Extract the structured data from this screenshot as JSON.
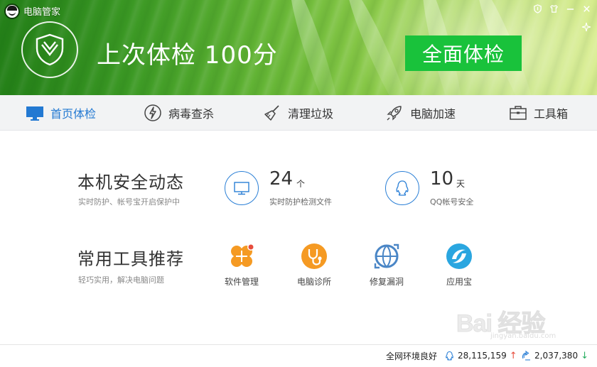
{
  "app": {
    "title": "电脑管家"
  },
  "window_controls": [
    "shield-icon",
    "shirt-icon",
    "minimize-icon",
    "close-icon"
  ],
  "header": {
    "last_check_text": "上次体检 100分",
    "full_check_button": "全面体检"
  },
  "nav": {
    "items": [
      {
        "label": "首页体检",
        "icon": "monitor-icon",
        "active": true
      },
      {
        "label": "病毒查杀",
        "icon": "lightning-icon",
        "active": false
      },
      {
        "label": "清理垃圾",
        "icon": "broom-icon",
        "active": false
      },
      {
        "label": "电脑加速",
        "icon": "rocket-icon",
        "active": false
      },
      {
        "label": "工具箱",
        "icon": "toolbox-icon",
        "active": false
      }
    ]
  },
  "security": {
    "title": "本机安全动态",
    "subtitle": "实时防护、帐号宝开启保护中",
    "stats": [
      {
        "value": "24",
        "unit": "个",
        "desc": "实时防护检测文件",
        "icon": "monitor-icon"
      },
      {
        "value": "10",
        "unit": "天",
        "desc": "QQ帐号安全",
        "icon": "qq-penguin-icon"
      }
    ]
  },
  "tools": {
    "title": "常用工具推荐",
    "subtitle": "轻巧实用，解决电脑问题",
    "items": [
      {
        "label": "软件管理",
        "icon": "clover-icon",
        "color": "#f59a23"
      },
      {
        "label": "电脑诊所",
        "icon": "stethoscope-icon",
        "color": "#f59a23"
      },
      {
        "label": "修复漏洞",
        "icon": "repair-globe-icon",
        "color": "#4a86c6"
      },
      {
        "label": "应用宝",
        "icon": "app-store-icon",
        "color": "#2aa6e0"
      }
    ]
  },
  "watermark": {
    "text": "Bai 经验",
    "url": "jingyan.baidu.com"
  },
  "statusbar": {
    "network_status": "全网环境良好",
    "count_up": "28,115,159",
    "count_down": "2,037,380"
  },
  "colors": {
    "accent_blue": "#2379d2",
    "button_green": "#19c23b",
    "header_green": "#47a62a"
  }
}
